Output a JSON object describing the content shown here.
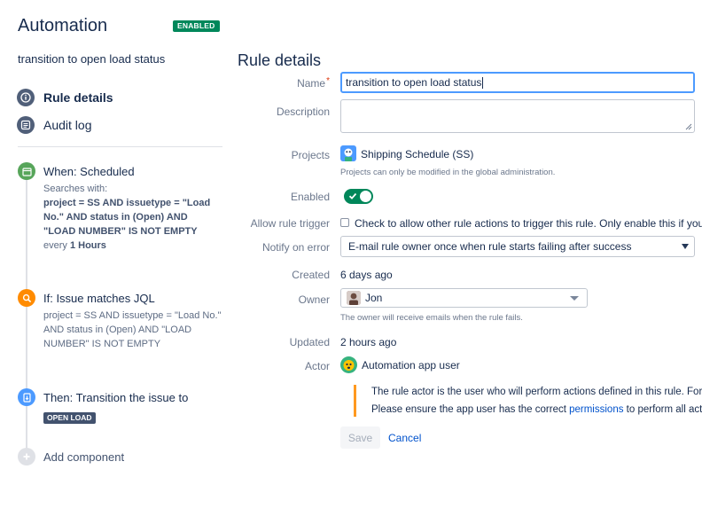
{
  "header": {
    "title": "Automation",
    "status_badge": "ENABLED",
    "rule_name": "transition to open load status"
  },
  "sidebar": {
    "nav": [
      {
        "label": "Rule details",
        "icon": "info-icon",
        "active": true
      },
      {
        "label": "Audit log",
        "icon": "list-icon",
        "active": false
      }
    ],
    "components": {
      "trigger": {
        "title": "When: Scheduled",
        "desc_prefix": "Searches with:",
        "desc_query_lines": [
          "project = SS AND issuetype = \"Load",
          "No.\" AND status in (Open) AND",
          "\"LOAD NUMBER\" IS NOT EMPTY"
        ],
        "every_prefix": "every",
        "every_value": "1 Hours",
        "icon": "calendar-icon",
        "color": "#57a55a"
      },
      "condition": {
        "title": "If: Issue matches JQL",
        "desc_lines": [
          "project = SS AND issuetype = \"Load No.\"",
          "AND status in (Open) AND \"LOAD",
          "NUMBER\" IS NOT EMPTY"
        ],
        "icon": "search-icon",
        "color": "#ff8b00"
      },
      "action": {
        "title": "Then: Transition the issue to",
        "status": "OPEN LOAD",
        "icon": "transition-icon",
        "color": "#4c9aff"
      },
      "add": {
        "label": "Add component",
        "icon": "plus-icon"
      }
    }
  },
  "main": {
    "title": "Rule details",
    "name": {
      "label": "Name",
      "required_mark": "*",
      "value": "transition to open load status"
    },
    "description": {
      "label": "Description",
      "value": ""
    },
    "projects": {
      "label": "Projects",
      "value": "Shipping Schedule (SS)",
      "helper": "Projects can only be modified in the global administration."
    },
    "enabled": {
      "label": "Enabled",
      "value": true
    },
    "allow_trigger": {
      "label": "Allow rule trigger",
      "text": "Check to allow other rule actions to trigger this rule. Only enable this if you need"
    },
    "notify": {
      "label": "Notify on error",
      "value": "E-mail rule owner once when rule starts failing after success"
    },
    "created": {
      "label": "Created",
      "value": "6 days ago"
    },
    "owner": {
      "label": "Owner",
      "value": "Jon",
      "helper": "The owner will receive emails when the rule fails."
    },
    "updated": {
      "label": "Updated",
      "value": "2 hours ago"
    },
    "actor": {
      "label": "Actor",
      "value": "Automation app user",
      "info_line1": "The rule actor is the user who will perform actions defined in this rule. For ex",
      "info_line2_prefix": "Please ensure the app user has the correct ",
      "info_line2_link": "permissions",
      "info_line2_suffix": " to perform all action"
    },
    "buttons": {
      "save": "Save",
      "cancel": "Cancel"
    }
  },
  "colors": {
    "primary_text": "#172b4d",
    "subtle_text": "#6b778c",
    "success_green": "#00875a",
    "link_blue": "#0052cc",
    "focus_blue": "#4c9aff",
    "warning_orange": "#ff991f"
  }
}
